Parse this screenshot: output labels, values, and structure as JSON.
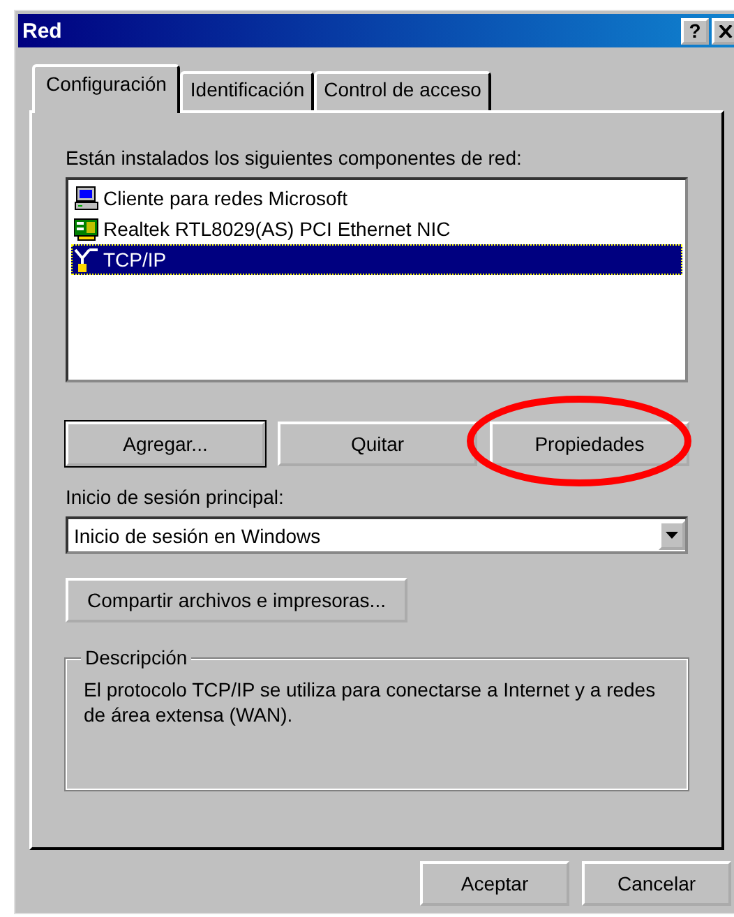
{
  "window": {
    "title": "Red",
    "help": "?"
  },
  "tabs": [
    {
      "label": "Configuración",
      "selected": true
    },
    {
      "label": "Identificación",
      "selected": false
    },
    {
      "label": "Control de acceso",
      "selected": false
    }
  ],
  "components": {
    "label": "Están instalados los siguientes componentes de red:",
    "items": [
      {
        "kind": "client",
        "name": "Cliente para redes Microsoft",
        "selected": false
      },
      {
        "kind": "adapter",
        "name": "Realtek RTL8029(AS) PCI Ethernet NIC",
        "selected": false
      },
      {
        "kind": "protocol",
        "name": "TCP/IP",
        "selected": true
      }
    ]
  },
  "component_buttons": [
    {
      "label": "Agregar...",
      "circled": false
    },
    {
      "label": "Quitar",
      "circled": false
    },
    {
      "label": "Propiedades",
      "circled": true
    }
  ],
  "logon": {
    "label": "Inicio de sesión principal:",
    "value": "Inicio de sesión en Windows"
  },
  "share_button": "Compartir archivos e impresoras...",
  "description": {
    "title": "Descripción",
    "text": "El protocolo TCP/IP se utiliza para conectarse a Internet y a redes de área extensa (WAN)."
  },
  "buttons": [
    "Aceptar",
    "Cancelar"
  ]
}
